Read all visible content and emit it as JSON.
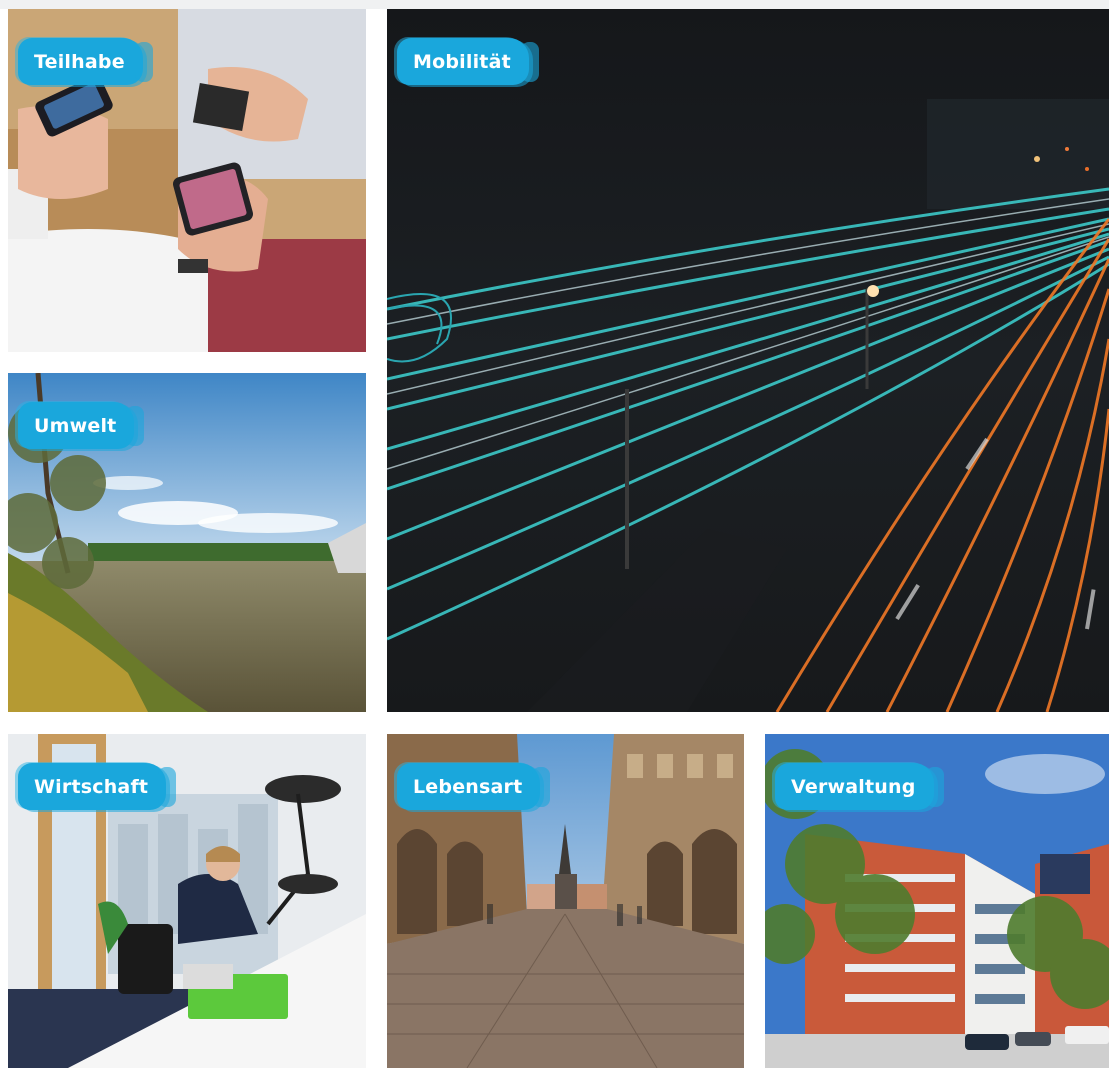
{
  "tiles": {
    "teilhabe": {
      "label": "Teilhabe"
    },
    "mobilitaet": {
      "label": "Mobilität"
    },
    "umwelt": {
      "label": "Umwelt"
    },
    "wirtschaft": {
      "label": "Wirtschaft"
    },
    "lebensart": {
      "label": "Lebensart"
    },
    "verwaltung": {
      "label": "Verwaltung"
    }
  },
  "colors": {
    "label_background": "#1aa7dc",
    "label_text": "#ffffff"
  }
}
